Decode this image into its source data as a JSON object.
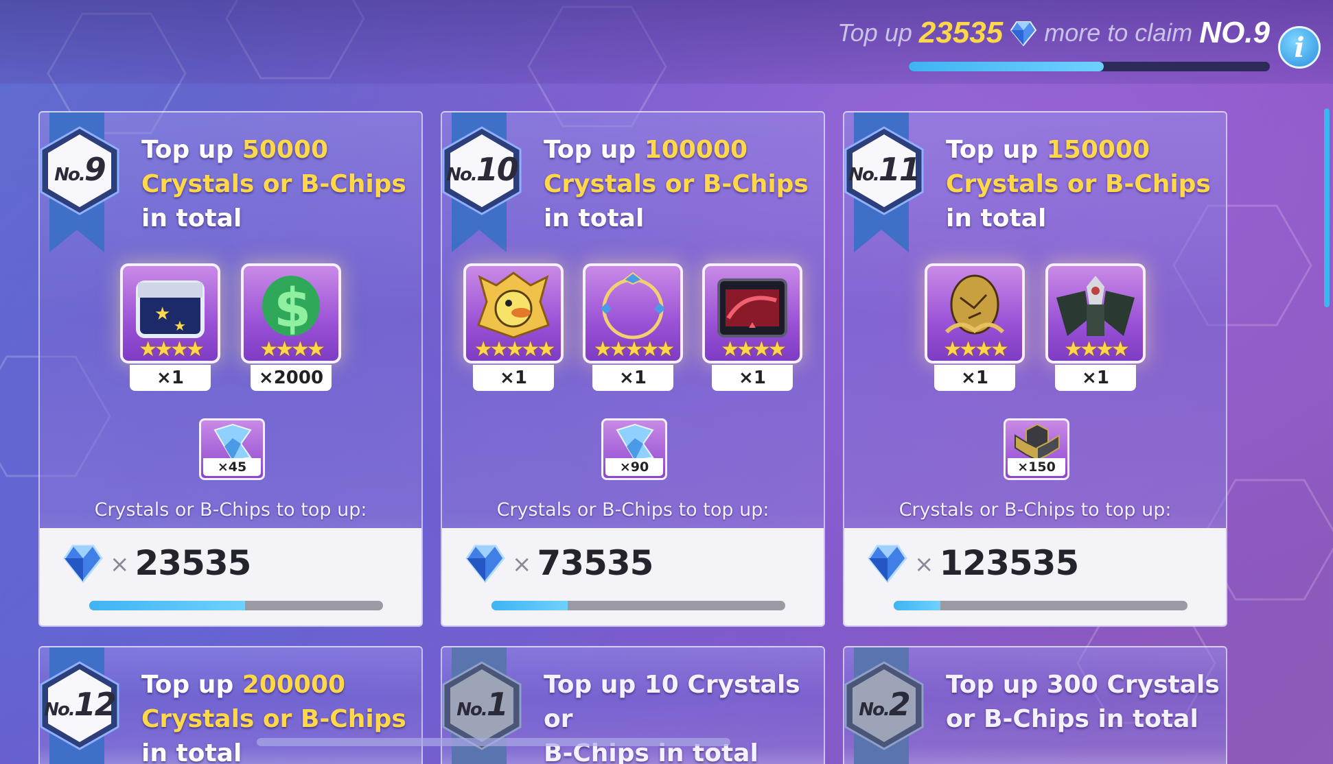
{
  "header": {
    "prefix": "Top up",
    "amount": "23535",
    "middle": "more to claim",
    "rank": "NO.9",
    "progress_fraction": 0.54,
    "info_label": "i"
  },
  "cards": [
    {
      "no_prefix": "No.",
      "no": "9",
      "title_a": "Top up ",
      "title_amount": "50000",
      "title_b": "Crystals or B-Chips",
      "title_c": "in total",
      "rewards": [
        {
          "icon": "star-chest-icon",
          "stars": "★★★★",
          "qty": "×1"
        },
        {
          "icon": "green-dollar-coin-icon",
          "stars": "★★★★",
          "qty": "×2000"
        }
      ],
      "bonus": {
        "icon": "crystal-shard-icon",
        "qty": "×45"
      },
      "topup_label": "Crystals or B-Chips to top up:",
      "remain_times": "×",
      "remain_value": "23535",
      "progress_fraction": 0.53
    },
    {
      "no_prefix": "No.",
      "no": "10",
      "title_a": "Top up ",
      "title_amount": "100000",
      "title_b": "Crystals or B-Chips",
      "title_c": "in total",
      "rewards": [
        {
          "icon": "duck-emblem-icon",
          "stars": "★★★★★",
          "qty": "×1"
        },
        {
          "icon": "gold-ring-frame-icon",
          "stars": "★★★★★",
          "qty": "×1"
        },
        {
          "icon": "dark-treasure-box-icon",
          "stars": "★★★★",
          "qty": "×1"
        }
      ],
      "bonus": {
        "icon": "crystal-shard-icon",
        "qty": "×90"
      },
      "topup_label": "Crystals or B-Chips to top up:",
      "remain_times": "×",
      "remain_value": "73535",
      "progress_fraction": 0.26
    },
    {
      "no_prefix": "No.",
      "no": "11",
      "title_a": "Top up ",
      "title_amount": "150000",
      "title_b": "Crystals or B-Chips",
      "title_c": "in total",
      "rewards": [
        {
          "icon": "golden-egg-icon",
          "stars": "★★★★",
          "qty": "×1"
        },
        {
          "icon": "mech-character-icon",
          "stars": "★★★★",
          "qty": "×1"
        }
      ],
      "bonus": {
        "icon": "gold-hex-chip-icon",
        "qty": "×150"
      },
      "topup_label": "Crystals or B-Chips to top up:",
      "remain_times": "×",
      "remain_value": "123535",
      "progress_fraction": 0.16
    },
    {
      "no_prefix": "No.",
      "no": "12",
      "title_a": "Top up ",
      "title_amount": "200000",
      "title_b": "Crystals or B-Chips",
      "title_c": "in total"
    },
    {
      "no_prefix": "No.",
      "no": "1",
      "title_a": "Top up ",
      "title_amount": "10",
      "title_b": " Crystals or",
      "title_c": "B-Chips in total"
    },
    {
      "no_prefix": "No.",
      "no": "2",
      "title_a": "Top up ",
      "title_amount": "300",
      "title_b": " Crystals",
      "title_c": "or B-Chips in total"
    }
  ],
  "colors": {
    "accent_gold": "#ffd84a",
    "progress_blue": "#3fb4f2",
    "ribbon_blue": "#3f6fc7"
  }
}
